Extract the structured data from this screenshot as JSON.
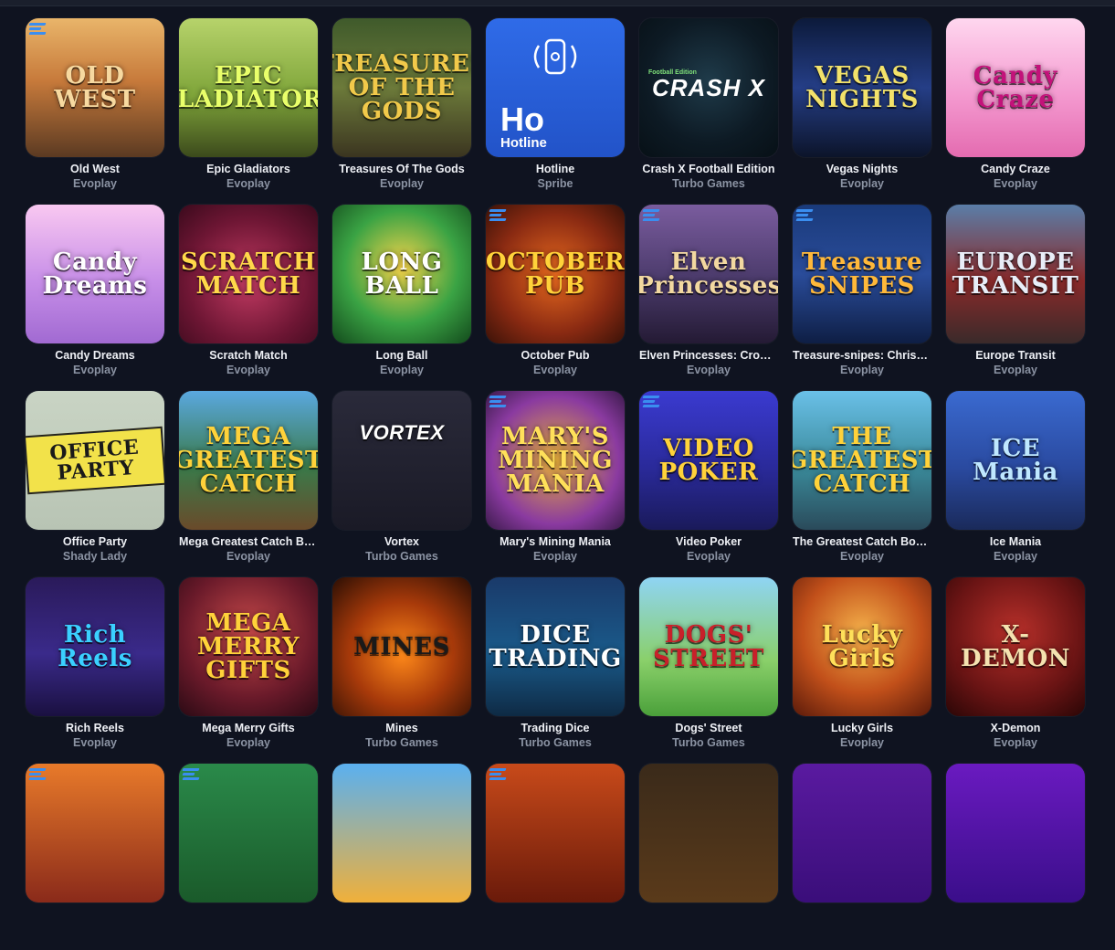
{
  "games": [
    {
      "name": "Old West",
      "provider": "Evoplay",
      "art_text": "OLD WEST",
      "bg": "linear-gradient(180deg,#e9b56a 0%,#c77a3b 45%,#5b3a22 100%)",
      "fg": "#f7d9a0",
      "logo": true
    },
    {
      "name": "Epic Gladiators",
      "provider": "Evoplay",
      "art_text": "EPIC GLADIATORS",
      "bg": "linear-gradient(180deg,#b7d36b 0%,#7fa53a 55%,#3c4a1c 100%)",
      "fg": "#e9ff6a",
      "logo": false
    },
    {
      "name": "Treasures Of The Gods",
      "provider": "Evoplay",
      "art_text": "TREASURES OF THE GODS",
      "bg": "linear-gradient(180deg,#3f5a2b 0%,#6c7a3a 50%,#3b3520 100%)",
      "fg": "#f1c94a",
      "logo": false
    },
    {
      "name": "Hotline",
      "provider": "Spribe",
      "art_text": "Ho",
      "art_sub": "Hotline",
      "bg": "linear-gradient(180deg,#2f6be8 0%,#2253c8 100%)",
      "fg": "#ffffff",
      "logo": false,
      "special": "hotline"
    },
    {
      "name": "Crash X Football Edition",
      "provider": "Turbo Games",
      "art_text": "CRASH X",
      "art_sub": "Football Edition",
      "bg": "radial-gradient(circle at 50% 45%,#1f3b4a 0%,#0d1a24 60%,#071016 100%)",
      "fg": "#ffffff",
      "logo": false,
      "special": "crash"
    },
    {
      "name": "Vegas Nights",
      "provider": "Evoplay",
      "art_text": "VEGAS NIGHTS",
      "bg": "linear-gradient(180deg,#0c1a3a 0%,#253e86 50%,#0c142a 100%)",
      "fg": "#f3e26a",
      "logo": false
    },
    {
      "name": "Candy Craze",
      "provider": "Evoplay",
      "art_text": "Candy Craze",
      "bg": "linear-gradient(180deg,#ffd7ef 0%,#f49ad0 55%,#e46bb0 100%)",
      "fg": "#c3127a",
      "logo": false
    },
    {
      "name": "Candy Dreams",
      "provider": "Evoplay",
      "art_text": "Candy Dreams",
      "bg": "linear-gradient(180deg,#f9c8f1 0%,#c78ee8 55%,#a16ad2 100%)",
      "fg": "#ffffff",
      "logo": false
    },
    {
      "name": "Scratch Match",
      "provider": "Evoplay",
      "art_text": "SCRATCH MATCH",
      "bg": "radial-gradient(circle at 50% 55%,#c23a62 0%,#6e1634 60%,#3a0a1c 100%)",
      "fg": "#ffd84a",
      "logo": false
    },
    {
      "name": "Long Ball",
      "provider": "Evoplay",
      "art_text": "LONG BALL",
      "bg": "radial-gradient(circle at 50% 45%,#f7d44a 0%,#3aa344 55%,#134a1c 100%)",
      "fg": "#ffffff",
      "logo": false
    },
    {
      "name": "October Pub",
      "provider": "Evoplay",
      "art_text": "OCTOBER PUB",
      "bg": "radial-gradient(circle at 50% 50%,#e86a1f 0%,#8a2a12 60%,#3a1208 100%)",
      "fg": "#ffd23a",
      "logo": true
    },
    {
      "name": "Elven Princesses: Crown Quest",
      "provider": "Evoplay",
      "art_text": "Elven Princesses",
      "bg": "linear-gradient(180deg,#7a5c9e 0%,#4a3a6a 55%,#241a34 100%)",
      "fg": "#f2d8a0",
      "logo": true
    },
    {
      "name": "Treasure-snipes: Christmas",
      "provider": "Evoplay",
      "art_text": "Treasure SNIPES",
      "bg": "linear-gradient(180deg,#1a3a7a 0%,#2a4c9a 50%,#0e1e44 100%)",
      "fg": "#ffb83a",
      "logo": true
    },
    {
      "name": "Europe Transit",
      "provider": "Evoplay",
      "art_text": "EUROPE TRANSIT",
      "bg": "linear-gradient(180deg,#5a7ea8 0%,#8a2a2a 55%,#3a2a2a 100%)",
      "fg": "#e8eef8",
      "logo": false
    },
    {
      "name": "Office Party",
      "provider": "Shady Lady",
      "art_text": "OFFICE PARTY",
      "bg": "linear-gradient(180deg,#c9d4c4 0%,#b8c4b4 100%)",
      "fg": "#1a1a1a",
      "logo": false,
      "special": "office"
    },
    {
      "name": "Mega Greatest Catch Bonus Buy",
      "provider": "Evoplay",
      "art_text": "MEGA GREATEST CATCH",
      "bg": "linear-gradient(180deg,#5aa8e0 0%,#3a7a4a 55%,#6a4a2a 100%)",
      "fg": "#ffd23a",
      "logo": false
    },
    {
      "name": "Vortex",
      "provider": "Turbo Games",
      "art_text": "VORTEX",
      "bg": "linear-gradient(180deg,#2a2a3a 0%,#1a1a26 100%)",
      "fg": "#ffffff",
      "logo": false,
      "special": "vortex"
    },
    {
      "name": "Mary's Mining Mania",
      "provider": "Evoplay",
      "art_text": "MARY'S MINING MANIA",
      "bg": "radial-gradient(circle at 50% 50%,#e8b03a 0%,#8a3aa0 65%,#3a1a4a 100%)",
      "fg": "#ffe05a",
      "logo": true
    },
    {
      "name": "Video Poker",
      "provider": "Evoplay",
      "art_text": "VIDEO POKER",
      "bg": "linear-gradient(180deg,#3a3ad0 0%,#2a2a9a 55%,#1a1a5a 100%)",
      "fg": "#ffd23a",
      "logo": true
    },
    {
      "name": "The Greatest Catch Bonus Buy",
      "provider": "Evoplay",
      "art_text": "THE GREATEST CATCH",
      "bg": "linear-gradient(180deg,#6ac0e8 0%,#3a8a9a 55%,#2a4a5a 100%)",
      "fg": "#ffd23a",
      "logo": false
    },
    {
      "name": "Ice Mania",
      "provider": "Evoplay",
      "art_text": "ICE Mania",
      "bg": "linear-gradient(180deg,#3a6ad0 0%,#2a4aa0 55%,#1a2a5a 100%)",
      "fg": "#bfe8ff",
      "logo": false
    },
    {
      "name": "Rich Reels",
      "provider": "Evoplay",
      "art_text": "Rich Reels",
      "bg": "linear-gradient(180deg,#2a1a5a 0%,#3a2a8a 55%,#1a1040 100%)",
      "fg": "#3ad0ff",
      "logo": false
    },
    {
      "name": "Mega Merry Gifts",
      "provider": "Evoplay",
      "art_text": "MEGA MERRY GIFTS",
      "bg": "radial-gradient(circle at 50% 40%,#c84a4a 0%,#6a1a2a 60%,#2a0a14 100%)",
      "fg": "#ffd23a",
      "logo": false
    },
    {
      "name": "Mines",
      "provider": "Turbo Games",
      "art_text": "MINES",
      "bg": "radial-gradient(circle at 50% 55%,#ff8a1a 0%,#a83a0a 50%,#2a0e04 100%)",
      "fg": "#1a1a1a",
      "logo": false
    },
    {
      "name": "Trading Dice",
      "provider": "Turbo Games",
      "art_text": "DICE TRADING",
      "bg": "linear-gradient(180deg,#1a3a6a 0%,#1a5a8a 55%,#0e2a44 100%)",
      "fg": "#ffffff",
      "logo": false
    },
    {
      "name": "Dogs' Street",
      "provider": "Turbo Games",
      "art_text": "DOGS' STREET",
      "bg": "linear-gradient(180deg,#8fd4f4 0%,#8ad06a 60%,#4aa03a 100%)",
      "fg": "#c8202a",
      "logo": false
    },
    {
      "name": "Lucky Girls",
      "provider": "Evoplay",
      "art_text": "Lucky Girls",
      "bg": "radial-gradient(circle at 50% 40%,#f4b04a 0%,#c2501a 55%,#5a1a0a 100%)",
      "fg": "#ffe05a",
      "logo": false
    },
    {
      "name": "X-Demon",
      "provider": "Evoplay",
      "art_text": "X-DEMON",
      "bg": "radial-gradient(circle at 50% 40%,#b8302a 0%,#6a1414 60%,#2a0606 100%)",
      "fg": "#f4e2b0",
      "logo": false
    },
    {
      "name": "",
      "provider": "",
      "art_text": "",
      "bg": "linear-gradient(180deg,#e87a2a 0%,#8a2a1a 100%)",
      "fg": "#fff",
      "logo": true
    },
    {
      "name": "",
      "provider": "",
      "art_text": "",
      "bg": "linear-gradient(180deg,#2a8a4a 0%,#1a5a2a 100%)",
      "fg": "#fff",
      "logo": true
    },
    {
      "name": "",
      "provider": "",
      "art_text": "",
      "bg": "linear-gradient(180deg,#5ab0f0 0%,#f0b03a 100%)",
      "fg": "#fff",
      "logo": false
    },
    {
      "name": "",
      "provider": "",
      "art_text": "",
      "bg": "linear-gradient(180deg,#c84a1a 0%,#6a1a0a 100%)",
      "fg": "#fff",
      "logo": true
    },
    {
      "name": "",
      "provider": "",
      "art_text": "",
      "bg": "linear-gradient(180deg,#3a2a1a 0%,#5a3a1a 100%)",
      "fg": "#fff",
      "logo": false
    },
    {
      "name": "",
      "provider": "",
      "art_text": "",
      "bg": "linear-gradient(180deg,#5a1aa0 0%,#3a0e7a 100%)",
      "fg": "#fff",
      "logo": false
    },
    {
      "name": "",
      "provider": "",
      "art_text": "",
      "bg": "linear-gradient(180deg,#6a1ac0 0%,#3a0e8a 100%)",
      "fg": "#fff",
      "logo": false
    }
  ]
}
